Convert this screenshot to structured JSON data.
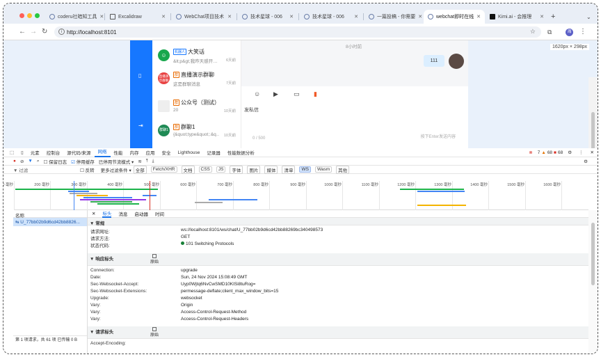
{
  "browser": {
    "tabs": [
      {
        "label": "coderu社暗知工具"
      },
      {
        "label": "Excalidraw"
      },
      {
        "label": "WebChat项目技术"
      },
      {
        "label": "技术星球 - 006"
      },
      {
        "label": "技术星球 - 006"
      },
      {
        "label": "一篇投稿 - 你需要"
      },
      {
        "label": "webchat即时在线"
      },
      {
        "label": "Kimi.ai - 会推理"
      }
    ],
    "url": "http://localhost:8101",
    "profile_letter": "海"
  },
  "viewport": {
    "size_badge": "1620px × 298px",
    "chat_list": [
      {
        "tag": "机器人",
        "name": "大笑话",
        "msg": "&lt;p&gt;我昨天感开…",
        "time": "6天前",
        "avatar_text": "",
        "avatar_color": "#19a74d"
      },
      {
        "tag": "群",
        "name": "直播演示群聊",
        "msg": "这是群聊消息",
        "time": "7天前",
        "avatar_text": "直播演示群聊",
        "avatar_color": "#e84343"
      },
      {
        "tag": "群",
        "name": "公众号（测试）",
        "msg": "20",
        "time": "10天前",
        "avatar_text": "",
        "avatar_color": "#dcdcdc"
      },
      {
        "tag": "群",
        "name": "群聊1",
        "msg": "{&quot;type&quot;:&q…",
        "time": "10天前",
        "avatar_text": "群聊1",
        "avatar_color": "#1f8a55"
      }
    ],
    "chat": {
      "time_hint": "8小时前",
      "bubble": "111",
      "private_msg": "发私信",
      "counter": "0 / 500",
      "send_hint": "按下Enter发送内容"
    }
  },
  "devtools": {
    "panels": [
      "元素",
      "控制台",
      "源代码/来源",
      "网络",
      "性能",
      "内存",
      "应用",
      "安全",
      "Lighthouse",
      "记录器",
      "性能数据分析"
    ],
    "active_panel": "网络",
    "badges": {
      "errors": "7",
      "warnings": "68",
      "info": "68"
    },
    "toolbar": {
      "preserve_log": "保留日志",
      "disable_cache": "停用缓存",
      "throttle": "已停用节流模式"
    },
    "filter": {
      "placeholder": "过滤",
      "invert": "反转",
      "more": "更多过滤条件",
      "types": [
        "全部",
        "Fetch/XHR",
        "文档",
        "CSS",
        "JS",
        "字体",
        "图片",
        "媒体",
        "清单",
        "WS",
        "Wasm",
        "其他"
      ],
      "active_type": "WS"
    },
    "timeline_ticks": [
      "100 毫秒",
      "200 毫秒",
      "300 毫秒",
      "400 毫秒",
      "500 毫秒",
      "600 毫秒",
      "700 毫秒",
      "800 毫秒",
      "900 毫秒",
      "1000 毫秒",
      "1100 毫秒",
      "1200 毫秒",
      "1300 毫秒",
      "1400 毫秒",
      "1500 毫秒",
      "1600 毫秒"
    ],
    "name_header": "名称",
    "request_name": "U_77bb02b9d6cd42bb8826...",
    "status_bar": "第 1 项请求，共 61 项    已传输 0 B",
    "detail_tabs": [
      "标头",
      "消息",
      "启动器",
      "时间"
    ],
    "active_detail_tab": "标头",
    "general": {
      "title": "▼ 常规",
      "rows": [
        {
          "k": "请求网址:",
          "v": "ws://localhost:8101/ws/chat/U_77bb02b9d6cd42bb88269bc340498573"
        },
        {
          "k": "请求方法:",
          "v": "GET"
        },
        {
          "k": "状态代码:",
          "v": "101 Switching Protocols"
        }
      ]
    },
    "response_headers": {
      "title": "▼ 响应标头",
      "raw": "原始",
      "rows": [
        {
          "k": "Connection:",
          "v": "upgrade"
        },
        {
          "k": "Date:",
          "v": "Sun, 24 Nov 2024 15:08:49 GMT"
        },
        {
          "k": "Sec-Websocket-Accept:",
          "v": "Uyp0Wjtq6NvCwSMD10KISi8tuRog="
        },
        {
          "k": "Sec-Websocket-Extensions:",
          "v": "permessage-deflate;client_max_window_bits=15"
        },
        {
          "k": "Upgrade:",
          "v": "websocket"
        },
        {
          "k": "Vary:",
          "v": "Origin"
        },
        {
          "k": "Vary:",
          "v": "Access-Control-Request-Method"
        },
        {
          "k": "Vary:",
          "v": "Access-Control-Request-Headers"
        }
      ]
    },
    "request_headers": {
      "title": "▼ 请求标头",
      "raw": "原始",
      "partial_row": "Accept-Encoding:"
    }
  }
}
